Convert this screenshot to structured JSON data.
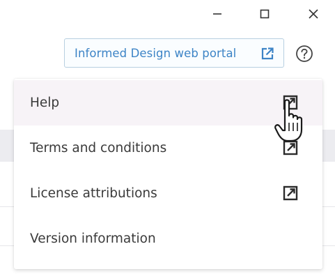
{
  "window_controls": {
    "minimize_icon": "minimize-icon",
    "maximize_icon": "maximize-icon",
    "close_icon": "close-icon"
  },
  "portal_link": {
    "label": "Informed Design web portal",
    "icon": "external-link-icon",
    "color": "#3d84c6"
  },
  "help_button": {
    "icon": "question-circle-icon"
  },
  "help_menu": {
    "items": [
      {
        "label": "Help",
        "external": true,
        "hovered": true
      },
      {
        "label": "Terms and conditions",
        "external": true,
        "hovered": false
      },
      {
        "label": "License attributions",
        "external": true,
        "hovered": false
      },
      {
        "label": "Version information",
        "external": false,
        "hovered": false
      }
    ]
  },
  "cursor": {
    "type": "hand-pointer"
  }
}
